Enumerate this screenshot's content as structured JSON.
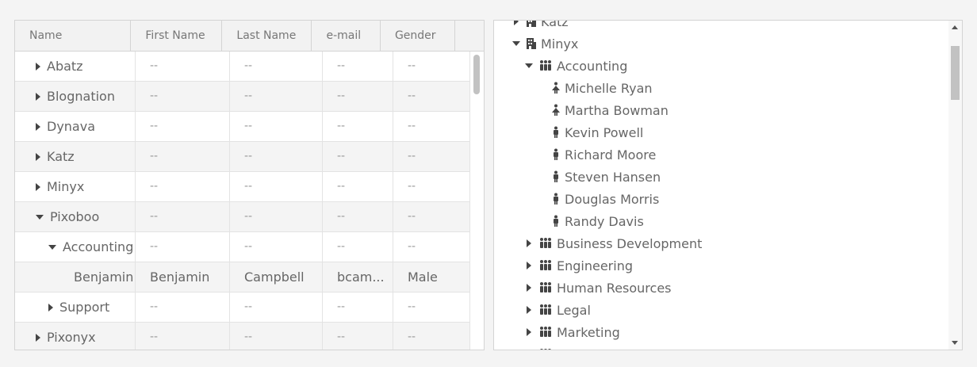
{
  "grid": {
    "columns": [
      "Name",
      "First Name",
      "Last Name",
      "e-mail",
      "Gender"
    ],
    "rows": [
      {
        "name": "Abatz",
        "toggle": "collapsed",
        "level": 0,
        "first": "--",
        "last": "--",
        "email": "--",
        "gender": "--"
      },
      {
        "name": "Blognation",
        "toggle": "collapsed",
        "level": 0,
        "first": "--",
        "last": "--",
        "email": "--",
        "gender": "--"
      },
      {
        "name": "Dynava",
        "toggle": "collapsed",
        "level": 0,
        "first": "--",
        "last": "--",
        "email": "--",
        "gender": "--"
      },
      {
        "name": "Katz",
        "toggle": "collapsed",
        "level": 0,
        "first": "--",
        "last": "--",
        "email": "--",
        "gender": "--"
      },
      {
        "name": "Minyx",
        "toggle": "collapsed",
        "level": 0,
        "first": "--",
        "last": "--",
        "email": "--",
        "gender": "--"
      },
      {
        "name": "Pixoboo",
        "toggle": "expanded",
        "level": 0,
        "first": "--",
        "last": "--",
        "email": "--",
        "gender": "--"
      },
      {
        "name": "Accounting",
        "toggle": "expanded",
        "level": 1,
        "first": "--",
        "last": "--",
        "email": "--",
        "gender": "--"
      },
      {
        "name": "Benjamin Campbell",
        "toggle": "none",
        "level": 2,
        "first": "Benjamin",
        "last": "Campbell",
        "email": "bcam...",
        "gender": "Male"
      },
      {
        "name": "Support",
        "toggle": "collapsed",
        "level": 1,
        "first": "--",
        "last": "--",
        "email": "--",
        "gender": "--"
      },
      {
        "name": "Pixonyx",
        "toggle": "collapsed",
        "level": 0,
        "first": "--",
        "last": "--",
        "email": "--",
        "gender": "--"
      }
    ]
  },
  "tree": {
    "nodes": [
      {
        "label": "Katz",
        "icon": "building-icon",
        "toggle": "collapsed",
        "level": 0
      },
      {
        "label": "Minyx",
        "icon": "building-icon",
        "toggle": "expanded",
        "level": 0
      },
      {
        "label": "Accounting",
        "icon": "group-icon",
        "toggle": "expanded",
        "level": 1
      },
      {
        "label": "Michelle Ryan",
        "icon": "female-icon",
        "toggle": "none",
        "level": 2
      },
      {
        "label": "Martha Bowman",
        "icon": "female-icon",
        "toggle": "none",
        "level": 2
      },
      {
        "label": "Kevin Powell",
        "icon": "male-icon",
        "toggle": "none",
        "level": 2
      },
      {
        "label": "Richard Moore",
        "icon": "male-icon",
        "toggle": "none",
        "level": 2
      },
      {
        "label": "Steven Hansen",
        "icon": "male-icon",
        "toggle": "none",
        "level": 2
      },
      {
        "label": "Douglas Morris",
        "icon": "male-icon",
        "toggle": "none",
        "level": 2
      },
      {
        "label": "Randy Davis",
        "icon": "male-icon",
        "toggle": "none",
        "level": 2
      },
      {
        "label": "Business Development",
        "icon": "group-icon",
        "toggle": "collapsed",
        "level": 1
      },
      {
        "label": "Engineering",
        "icon": "group-icon",
        "toggle": "collapsed",
        "level": 1
      },
      {
        "label": "Human Resources",
        "icon": "group-icon",
        "toggle": "collapsed",
        "level": 1
      },
      {
        "label": "Legal",
        "icon": "group-icon",
        "toggle": "collapsed",
        "level": 1
      },
      {
        "label": "Marketing",
        "icon": "group-icon",
        "toggle": "collapsed",
        "level": 1
      },
      {
        "label": "Product Management",
        "icon": "group-icon",
        "toggle": "collapsed",
        "level": 1
      }
    ]
  }
}
